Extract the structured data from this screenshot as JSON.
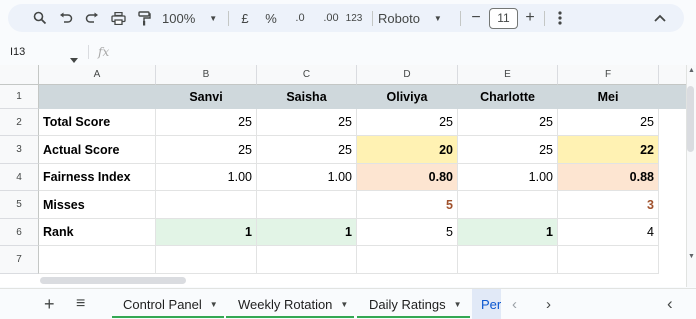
{
  "toolbar": {
    "zoom": "100%",
    "currency": "£",
    "percent": "%",
    "decrease_decimals": ".0",
    "increase_decimals": ".00",
    "more_formats": "123",
    "font": "Roboto",
    "font_size": "11",
    "decrease_font": "−",
    "increase_font": "+"
  },
  "formula_bar": {
    "cell_ref": "I13",
    "fx": "fx",
    "value": ""
  },
  "columns": [
    "A",
    "B",
    "C",
    "D",
    "E",
    "F"
  ],
  "rows": [
    "1",
    "2",
    "3",
    "4",
    "5",
    "6",
    "7"
  ],
  "sheet": {
    "header": [
      "",
      "Sanvi",
      "Saisha",
      "Oliviya",
      "Charlotte",
      "Mei"
    ],
    "rows": [
      {
        "label": "Total Score",
        "values": [
          "25",
          "25",
          "25",
          "25",
          "25"
        ]
      },
      {
        "label": "Actual Score",
        "values": [
          "25",
          "25",
          "20",
          "25",
          "22"
        ]
      },
      {
        "label": "Fairness Index",
        "values": [
          "1.00",
          "1.00",
          "0.80",
          "1.00",
          "0.88"
        ]
      },
      {
        "label": "Misses",
        "values": [
          "",
          "",
          "5",
          "",
          "3"
        ]
      },
      {
        "label": "Rank",
        "values": [
          "1",
          "1",
          "5",
          "1",
          "4"
        ]
      }
    ]
  },
  "colors": {
    "header_fill": "#cfd8dc",
    "yellow_fill": "#fff2b3",
    "peach_fill": "#fde5d1",
    "green_fill": "#e2f4e6",
    "misses_text": "#a0522d"
  },
  "tabs": {
    "add": "+",
    "all_sheets": "≡",
    "items": [
      "Control Panel",
      "Weekly Rotation",
      "Daily Ratings",
      "Per"
    ]
  }
}
